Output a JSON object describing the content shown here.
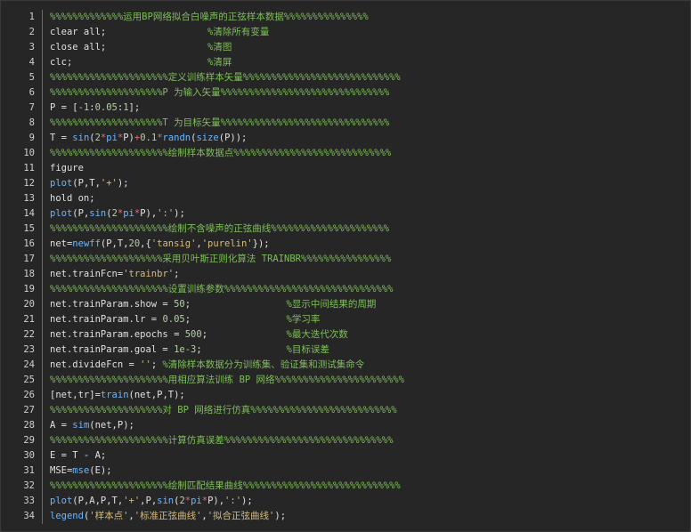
{
  "lines": [
    {
      "n": "1",
      "segs": [
        {
          "t": "%%%%%%%%%%%%%运用BP网络拟合白噪声的正弦样本数据%%%%%%%%%%%%%%%",
          "c": "cm"
        }
      ]
    },
    {
      "n": "2",
      "segs": [
        {
          "t": "clear all;                  ",
          "c": "fn"
        },
        {
          "t": "%清除所有变量",
          "c": "cm"
        }
      ]
    },
    {
      "n": "3",
      "segs": [
        {
          "t": "close all;                  ",
          "c": "fn"
        },
        {
          "t": "%清图",
          "c": "cm"
        }
      ]
    },
    {
      "n": "4",
      "segs": [
        {
          "t": "clc;                        ",
          "c": "fn"
        },
        {
          "t": "%清屏",
          "c": "cm"
        }
      ]
    },
    {
      "n": "5",
      "segs": [
        {
          "t": "%%%%%%%%%%%%%%%%%%%%%定义训练样本矢量%%%%%%%%%%%%%%%%%%%%%%%%%%%%",
          "c": "cm"
        }
      ]
    },
    {
      "n": "6",
      "segs": [
        {
          "t": "%%%%%%%%%%%%%%%%%%%%P 为输入矢量%%%%%%%%%%%%%%%%%%%%%%%%%%%%%%",
          "c": "cm"
        }
      ]
    },
    {
      "n": "7",
      "segs": [
        {
          "t": "P = [",
          "c": "fn"
        },
        {
          "t": "-1",
          "c": "num"
        },
        {
          "t": ":",
          "c": "fn"
        },
        {
          "t": "0.05",
          "c": "num"
        },
        {
          "t": ":",
          "c": "fn"
        },
        {
          "t": "1",
          "c": "num"
        },
        {
          "t": "];",
          "c": "fn"
        }
      ]
    },
    {
      "n": "8",
      "segs": [
        {
          "t": "%%%%%%%%%%%%%%%%%%%%T 为目标矢量%%%%%%%%%%%%%%%%%%%%%%%%%%%%%%",
          "c": "cm"
        }
      ]
    },
    {
      "n": "9",
      "segs": [
        {
          "t": "T = ",
          "c": "fn"
        },
        {
          "t": "sin",
          "c": "kw"
        },
        {
          "t": "(",
          "c": "fn"
        },
        {
          "t": "2",
          "c": "num"
        },
        {
          "t": "*",
          "c": "op"
        },
        {
          "t": "pi",
          "c": "kw"
        },
        {
          "t": "*",
          "c": "op"
        },
        {
          "t": "P)",
          "c": "fn"
        },
        {
          "t": "+",
          "c": "op"
        },
        {
          "t": "0.1",
          "c": "num"
        },
        {
          "t": "*",
          "c": "op"
        },
        {
          "t": "randn",
          "c": "kw"
        },
        {
          "t": "(",
          "c": "fn"
        },
        {
          "t": "size",
          "c": "kw"
        },
        {
          "t": "(P));",
          "c": "fn"
        }
      ]
    },
    {
      "n": "10",
      "segs": [
        {
          "t": "%%%%%%%%%%%%%%%%%%%%%绘制样本数据点%%%%%%%%%%%%%%%%%%%%%%%%%%%%",
          "c": "cm"
        }
      ]
    },
    {
      "n": "11",
      "segs": [
        {
          "t": "figure",
          "c": "fn"
        }
      ]
    },
    {
      "n": "12",
      "segs": [
        {
          "t": "plot",
          "c": "kw"
        },
        {
          "t": "(P,T,",
          "c": "fn"
        },
        {
          "t": "'+'",
          "c": "str"
        },
        {
          "t": ");",
          "c": "fn"
        }
      ]
    },
    {
      "n": "13",
      "segs": [
        {
          "t": "hold on;",
          "c": "fn"
        }
      ]
    },
    {
      "n": "14",
      "segs": [
        {
          "t": "plot",
          "c": "kw"
        },
        {
          "t": "(P,",
          "c": "fn"
        },
        {
          "t": "sin",
          "c": "kw"
        },
        {
          "t": "(",
          "c": "fn"
        },
        {
          "t": "2",
          "c": "num"
        },
        {
          "t": "*",
          "c": "op"
        },
        {
          "t": "pi",
          "c": "kw"
        },
        {
          "t": "*",
          "c": "op"
        },
        {
          "t": "P),",
          "c": "fn"
        },
        {
          "t": "':'",
          "c": "str"
        },
        {
          "t": ");",
          "c": "fn"
        }
      ]
    },
    {
      "n": "15",
      "segs": [
        {
          "t": "%%%%%%%%%%%%%%%%%%%%%绘制不含噪声的正弦曲线%%%%%%%%%%%%%%%%%%%%%",
          "c": "cm"
        }
      ]
    },
    {
      "n": "16",
      "segs": [
        {
          "t": "net=",
          "c": "fn"
        },
        {
          "t": "newff",
          "c": "kw"
        },
        {
          "t": "(P,T,",
          "c": "fn"
        },
        {
          "t": "20",
          "c": "num"
        },
        {
          "t": ",{",
          "c": "fn"
        },
        {
          "t": "'tansig'",
          "c": "str"
        },
        {
          "t": ",",
          "c": "fn"
        },
        {
          "t": "'purelin'",
          "c": "str"
        },
        {
          "t": "});",
          "c": "fn"
        }
      ]
    },
    {
      "n": "17",
      "segs": [
        {
          "t": "%%%%%%%%%%%%%%%%%%%%采用贝叶斯正则化算法 TRAINBR%%%%%%%%%%%%%%%%",
          "c": "cm"
        }
      ]
    },
    {
      "n": "18",
      "segs": [
        {
          "t": "net.trainFcn=",
          "c": "fn"
        },
        {
          "t": "'trainbr'",
          "c": "str"
        },
        {
          "t": ";",
          "c": "fn"
        }
      ]
    },
    {
      "n": "19",
      "segs": [
        {
          "t": "%%%%%%%%%%%%%%%%%%%%%设置训练参数%%%%%%%%%%%%%%%%%%%%%%%%%%%%%%",
          "c": "cm"
        }
      ]
    },
    {
      "n": "20",
      "segs": [
        {
          "t": "net.trainParam.show = ",
          "c": "fn"
        },
        {
          "t": "50",
          "c": "num"
        },
        {
          "t": ";                 ",
          "c": "fn"
        },
        {
          "t": "%显示中间结果的周期",
          "c": "cm"
        }
      ]
    },
    {
      "n": "21",
      "segs": [
        {
          "t": "net.trainParam.lr = ",
          "c": "fn"
        },
        {
          "t": "0.05",
          "c": "num"
        },
        {
          "t": ";                 ",
          "c": "fn"
        },
        {
          "t": "%学习率",
          "c": "cm"
        }
      ]
    },
    {
      "n": "22",
      "segs": [
        {
          "t": "net.trainParam.epochs = ",
          "c": "fn"
        },
        {
          "t": "500",
          "c": "num"
        },
        {
          "t": ";              ",
          "c": "fn"
        },
        {
          "t": "%最大迭代次数",
          "c": "cm"
        }
      ]
    },
    {
      "n": "23",
      "segs": [
        {
          "t": "net.trainParam.goal = ",
          "c": "fn"
        },
        {
          "t": "1e-3",
          "c": "num"
        },
        {
          "t": ";               ",
          "c": "fn"
        },
        {
          "t": "%目标误差",
          "c": "cm"
        }
      ]
    },
    {
      "n": "24",
      "segs": [
        {
          "t": "net.divideFcn = ",
          "c": "fn"
        },
        {
          "t": "''",
          "c": "str"
        },
        {
          "t": "; ",
          "c": "fn"
        },
        {
          "t": "%清除样本数据分为训练集、验证集和测试集命令",
          "c": "cm"
        }
      ]
    },
    {
      "n": "25",
      "segs": [
        {
          "t": "%%%%%%%%%%%%%%%%%%%%%用相应算法训练 BP 网络%%%%%%%%%%%%%%%%%%%%%%%",
          "c": "cm"
        }
      ]
    },
    {
      "n": "26",
      "segs": [
        {
          "t": "[net,tr]=",
          "c": "fn"
        },
        {
          "t": "train",
          "c": "kw"
        },
        {
          "t": "(net,P,T);",
          "c": "fn"
        }
      ]
    },
    {
      "n": "27",
      "segs": [
        {
          "t": "%%%%%%%%%%%%%%%%%%%%对 BP 网络进行仿真%%%%%%%%%%%%%%%%%%%%%%%%%%",
          "c": "cm"
        }
      ]
    },
    {
      "n": "28",
      "segs": [
        {
          "t": "A = ",
          "c": "fn"
        },
        {
          "t": "sim",
          "c": "kw"
        },
        {
          "t": "(net,P);",
          "c": "fn"
        }
      ]
    },
    {
      "n": "29",
      "segs": [
        {
          "t": "%%%%%%%%%%%%%%%%%%%%%计算仿真误差%%%%%%%%%%%%%%%%%%%%%%%%%%%%%%",
          "c": "cm"
        }
      ]
    },
    {
      "n": "30",
      "segs": [
        {
          "t": "E = T - A;",
          "c": "fn"
        }
      ]
    },
    {
      "n": "31",
      "segs": [
        {
          "t": "MSE=",
          "c": "fn"
        },
        {
          "t": "mse",
          "c": "kw"
        },
        {
          "t": "(E);",
          "c": "fn"
        }
      ]
    },
    {
      "n": "32",
      "segs": [
        {
          "t": "%%%%%%%%%%%%%%%%%%%%%绘制匹配结果曲线%%%%%%%%%%%%%%%%%%%%%%%%%%%%",
          "c": "cm"
        }
      ]
    },
    {
      "n": "33",
      "segs": [
        {
          "t": "plot",
          "c": "kw"
        },
        {
          "t": "(P,A,P,T,",
          "c": "fn"
        },
        {
          "t": "'+'",
          "c": "str"
        },
        {
          "t": ",P,",
          "c": "fn"
        },
        {
          "t": "sin",
          "c": "kw"
        },
        {
          "t": "(",
          "c": "fn"
        },
        {
          "t": "2",
          "c": "num"
        },
        {
          "t": "*",
          "c": "op"
        },
        {
          "t": "pi",
          "c": "kw"
        },
        {
          "t": "*",
          "c": "op"
        },
        {
          "t": "P),",
          "c": "fn"
        },
        {
          "t": "':'",
          "c": "str"
        },
        {
          "t": ");",
          "c": "fn"
        }
      ]
    },
    {
      "n": "34",
      "segs": [
        {
          "t": "legend",
          "c": "kw"
        },
        {
          "t": "(",
          "c": "fn"
        },
        {
          "t": "'样本点'",
          "c": "str"
        },
        {
          "t": ",",
          "c": "fn"
        },
        {
          "t": "'标准正弦曲线'",
          "c": "str"
        },
        {
          "t": ",",
          "c": "fn"
        },
        {
          "t": "'拟合正弦曲线'",
          "c": "str"
        },
        {
          "t": ");",
          "c": "fn"
        }
      ]
    }
  ]
}
